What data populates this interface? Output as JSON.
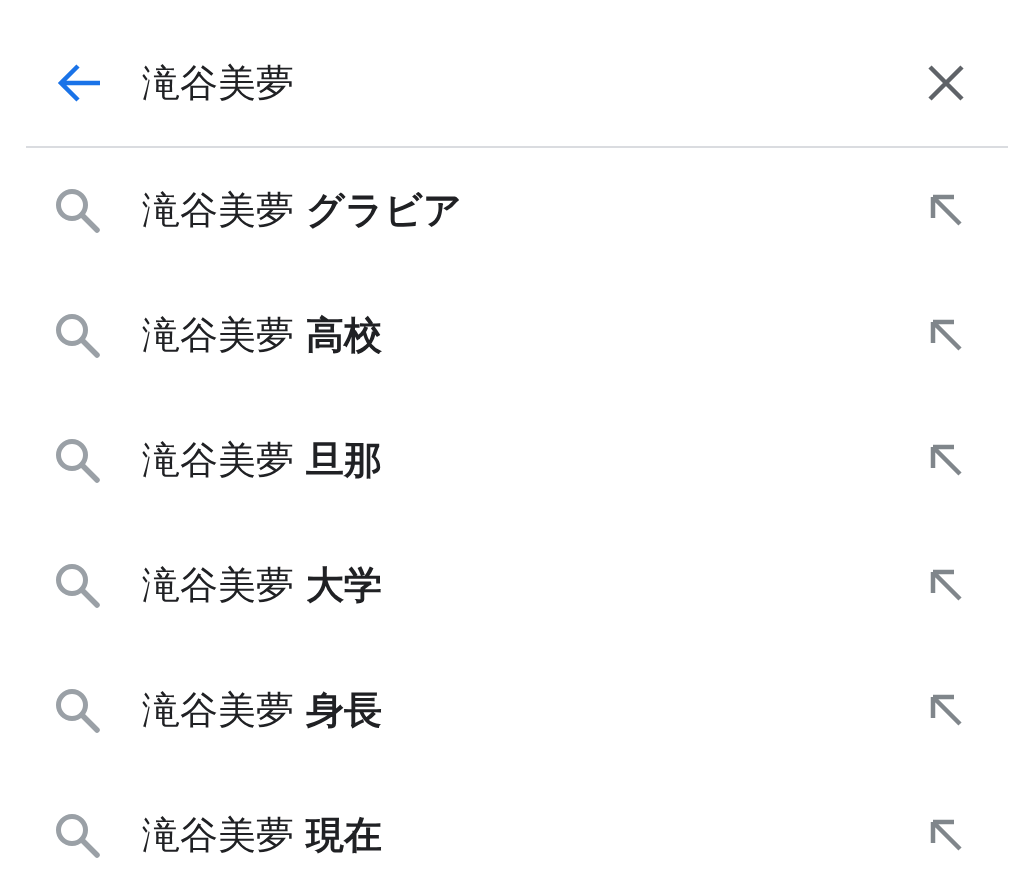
{
  "search_bar": {
    "value": "滝谷美夢"
  },
  "suggestions": [
    {
      "text": "滝谷美夢 **グラビア**"
    },
    {
      "text": "滝谷美夢 **高校**"
    },
    {
      "text": "滝谷美夢 **旦那**"
    },
    {
      "text": "滝谷美夢 **大学**"
    },
    {
      "text": "滝谷美夢 **身長**"
    },
    {
      "text": "滝谷美夢 **現在**"
    }
  ]
}
